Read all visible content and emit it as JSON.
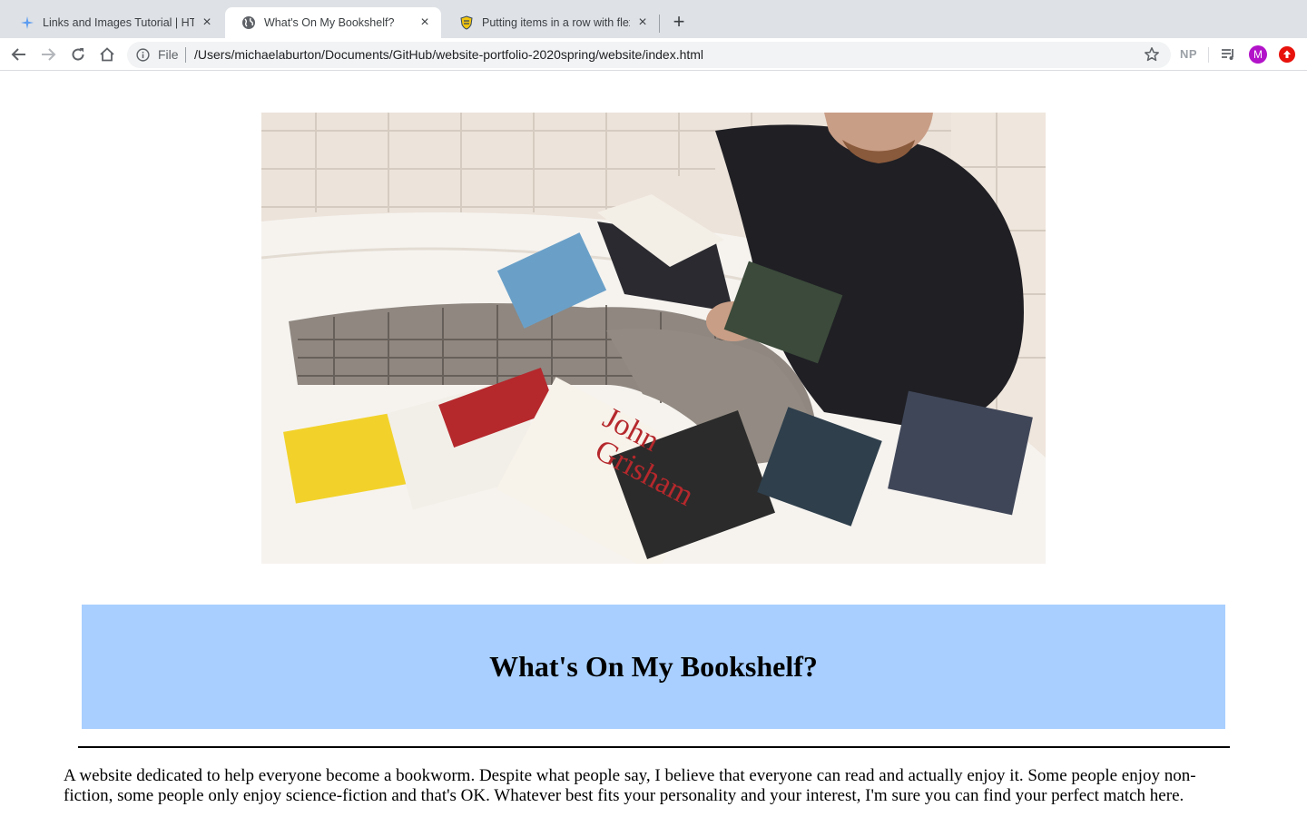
{
  "browser": {
    "tabs": [
      {
        "title": "Links and Images Tutorial | HTML",
        "icon": "dreamweaver-icon",
        "active": false
      },
      {
        "title": "What's On My Bookshelf?",
        "icon": "globe-icon",
        "active": true
      },
      {
        "title": "Putting items in a row with flex",
        "icon": "shield-crest-icon",
        "active": false
      }
    ],
    "omnibox": {
      "scheme_label": "File",
      "url": "/Users/michaelaburton/Documents/GitHub/website-portfolio-2020spring/website/index.html"
    },
    "extensions": {
      "np_label": "NP",
      "avatar_letter": "M"
    }
  },
  "page": {
    "hero_image": {
      "icon": "photo",
      "alt": "man-reading-books-in-bathtub-photo"
    },
    "heading": "What's On My Bookshelf?",
    "intro": "A website dedicated to help everyone become a bookworm. Despite what people say, I believe that everyone can read and actually enjoy it. Some people enjoy non-fiction, some people only enjoy science-fiction and that's OK. Whatever best fits your personality and your interest, I'm sure you can find your perfect match here."
  },
  "colors": {
    "banner_bg": "#a8cfff",
    "tabstrip_bg": "#dee1e6",
    "avatar_bg": "#b213c9",
    "extension_red": "#e8120c"
  }
}
